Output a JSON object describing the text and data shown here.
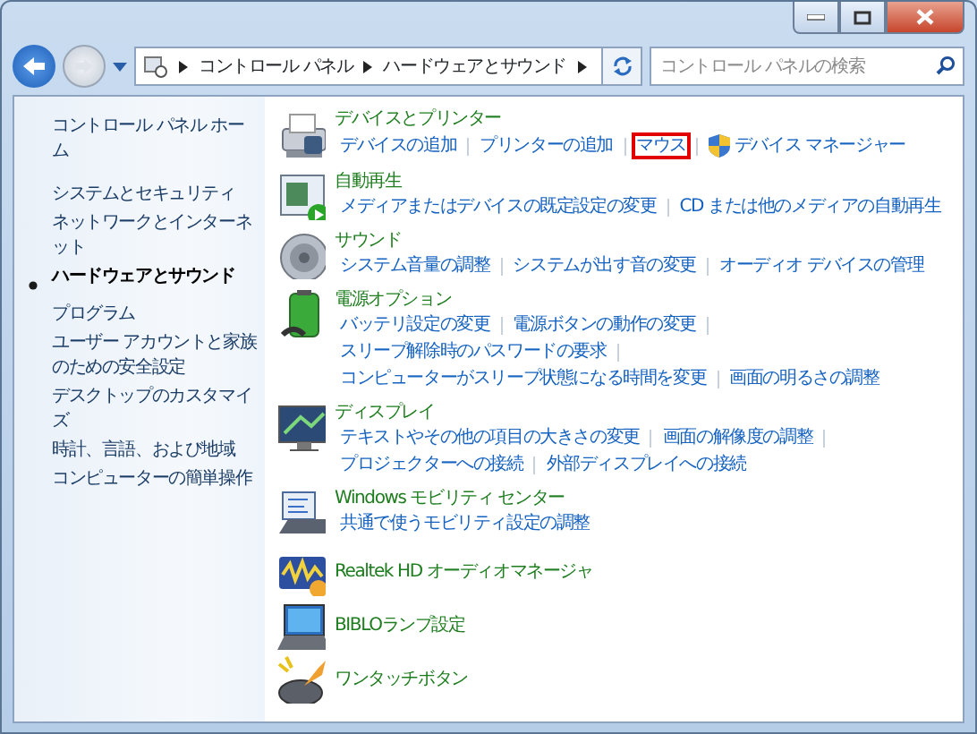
{
  "address_bar": {
    "crumbs": [
      "コントロール パネル",
      "ハードウェアとサウンド"
    ],
    "search": {
      "placeholder": "コントロール パネルの検索"
    }
  },
  "sidebar": {
    "items": [
      {
        "label": "コントロール パネル ホーム",
        "selected": false
      },
      {
        "label": "システムとセキュリティ",
        "selected": false
      },
      {
        "label": "ネットワークとインターネット",
        "selected": false
      },
      {
        "label": "ハードウェアとサウンド",
        "selected": true
      },
      {
        "label": "プログラム",
        "selected": false
      },
      {
        "label": "ユーザー アカウントと家族のための安全設定",
        "selected": false
      },
      {
        "label": "デスクトップのカスタマイズ",
        "selected": false
      },
      {
        "label": "時計、言語、および地域",
        "selected": false
      },
      {
        "label": "コンピューターの簡単操作",
        "selected": false
      }
    ]
  },
  "sections": [
    {
      "title": "デバイスとプリンター",
      "lines": [
        [
          {
            "label": "デバイスの追加",
            "highlighted": false,
            "shield": false
          },
          {
            "label": "プリンターの追加",
            "highlighted": false,
            "shield": false
          },
          {
            "label": "マウス",
            "highlighted": true,
            "shield": false
          },
          {
            "label": "デバイス マネージャー",
            "highlighted": false,
            "shield": true
          }
        ]
      ]
    },
    {
      "title": "自動再生",
      "lines": [
        [
          {
            "label": "メディアまたはデバイスの既定設定の変更",
            "highlighted": false,
            "shield": false
          },
          {
            "label": "CD または他のメディアの自動再生",
            "highlighted": false,
            "shield": false
          }
        ]
      ]
    },
    {
      "title": "サウンド",
      "lines": [
        [
          {
            "label": "システム音量の調整",
            "highlighted": false,
            "shield": false
          },
          {
            "label": "システムが出す音の変更",
            "highlighted": false,
            "shield": false
          },
          {
            "label": "オーディオ デバイスの管理",
            "highlighted": false,
            "shield": false
          }
        ]
      ]
    },
    {
      "title": "電源オプション",
      "lines": [
        [
          {
            "label": "バッテリ設定の変更",
            "highlighted": false,
            "shield": false
          },
          {
            "label": "電源ボタンの動作の変更",
            "highlighted": false,
            "shield": false
          }
        ],
        [
          {
            "label": "スリープ解除時のパスワードの要求",
            "highlighted": false,
            "shield": false
          }
        ],
        [
          {
            "label": "コンピューターがスリープ状態になる時間を変更",
            "highlighted": false,
            "shield": false
          },
          {
            "label": "画面の明るさの調整",
            "highlighted": false,
            "shield": false
          }
        ]
      ],
      "trailing_dividers": [
        true,
        true,
        false
      ]
    },
    {
      "title": "ディスプレイ",
      "lines": [
        [
          {
            "label": "テキストやその他の項目の大きさの変更",
            "highlighted": false,
            "shield": false
          },
          {
            "label": "画面の解像度の調整",
            "highlighted": false,
            "shield": false
          }
        ],
        [
          {
            "label": "プロジェクターへの接続",
            "highlighted": false,
            "shield": false
          },
          {
            "label": "外部ディスプレイへの接続",
            "highlighted": false,
            "shield": false
          }
        ]
      ],
      "trailing_dividers": [
        true,
        false
      ]
    },
    {
      "title": "Windows モビリティ センター",
      "lines": [
        [
          {
            "label": "共通で使うモビリティ設定の調整",
            "highlighted": false,
            "shield": false
          }
        ]
      ]
    },
    {
      "title": "Realtek HD オーディオマネージャ"
    },
    {
      "title": "BIBLOランプ設定"
    },
    {
      "title": "ワンタッチボタン"
    }
  ]
}
